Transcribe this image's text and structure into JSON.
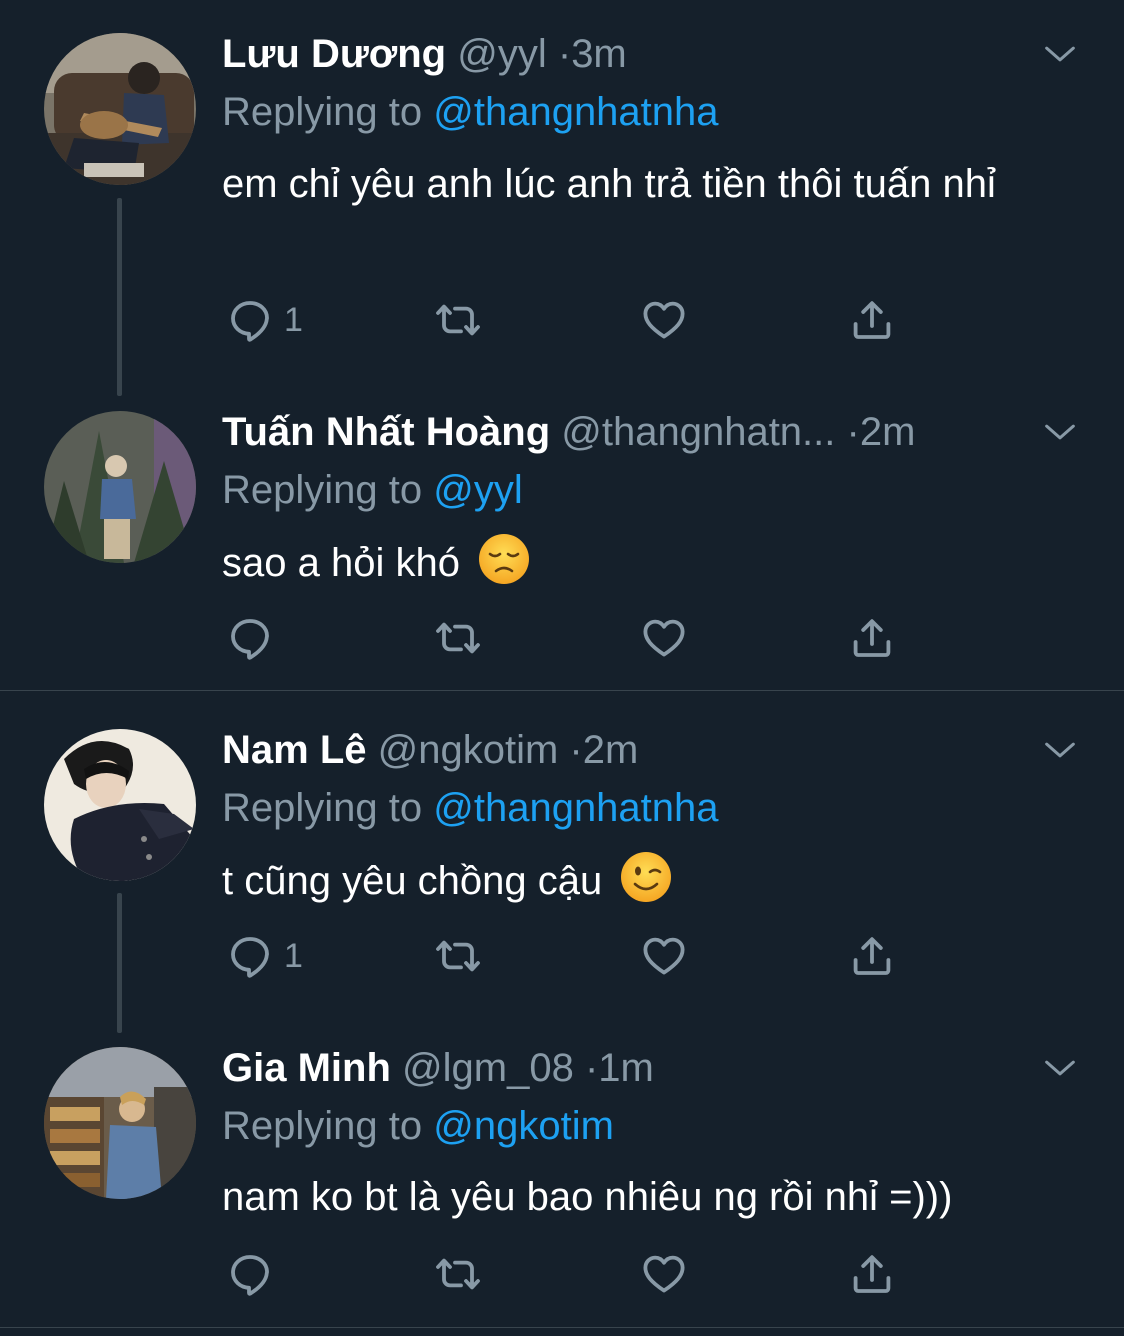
{
  "tweets": [
    {
      "name": "Lưu Dương",
      "handle": "@yyl",
      "sep": "·",
      "time": "3m",
      "replying_prefix": "Replying to ",
      "replying_to": "@thangnhatnha",
      "text": "em chỉ yêu anh lúc anh trả tiền thôi tuấn nhỉ",
      "reply_count": "1"
    },
    {
      "name": "Tuấn Nhất Hoàng",
      "handle": "@thangnhatn...",
      "sep": "·",
      "time": "2m",
      "replying_prefix": "Replying to ",
      "replying_to": "@yyl",
      "text": "sao a hỏi khó",
      "emoji": "disappointed-face",
      "reply_count": ""
    },
    {
      "name": "Nam Lê",
      "handle": "@ngkotim",
      "sep": "·",
      "time": "2m",
      "replying_prefix": "Replying to ",
      "replying_to": "@thangnhatnha",
      "text": "t cũng yêu chồng cậu",
      "emoji": "winking-face",
      "reply_count": "1"
    },
    {
      "name": "Gia Minh",
      "handle": "@lgm_08",
      "sep": "·",
      "time": "1m",
      "replying_prefix": "Replying to ",
      "replying_to": "@ngkotim",
      "text": "nam ko bt là yêu bao nhiêu ng rồi nhỉ =)))",
      "reply_count": ""
    }
  ],
  "icons": {
    "reply": "reply-icon",
    "retweet": "retweet-icon",
    "like": "heart-icon",
    "share": "share-icon",
    "menu": "chevron-down-icon"
  },
  "colors": {
    "background": "#15202b",
    "text": "#ffffff",
    "secondary": "#8899a6",
    "link": "#1da1f2",
    "divider": "#38444d"
  }
}
